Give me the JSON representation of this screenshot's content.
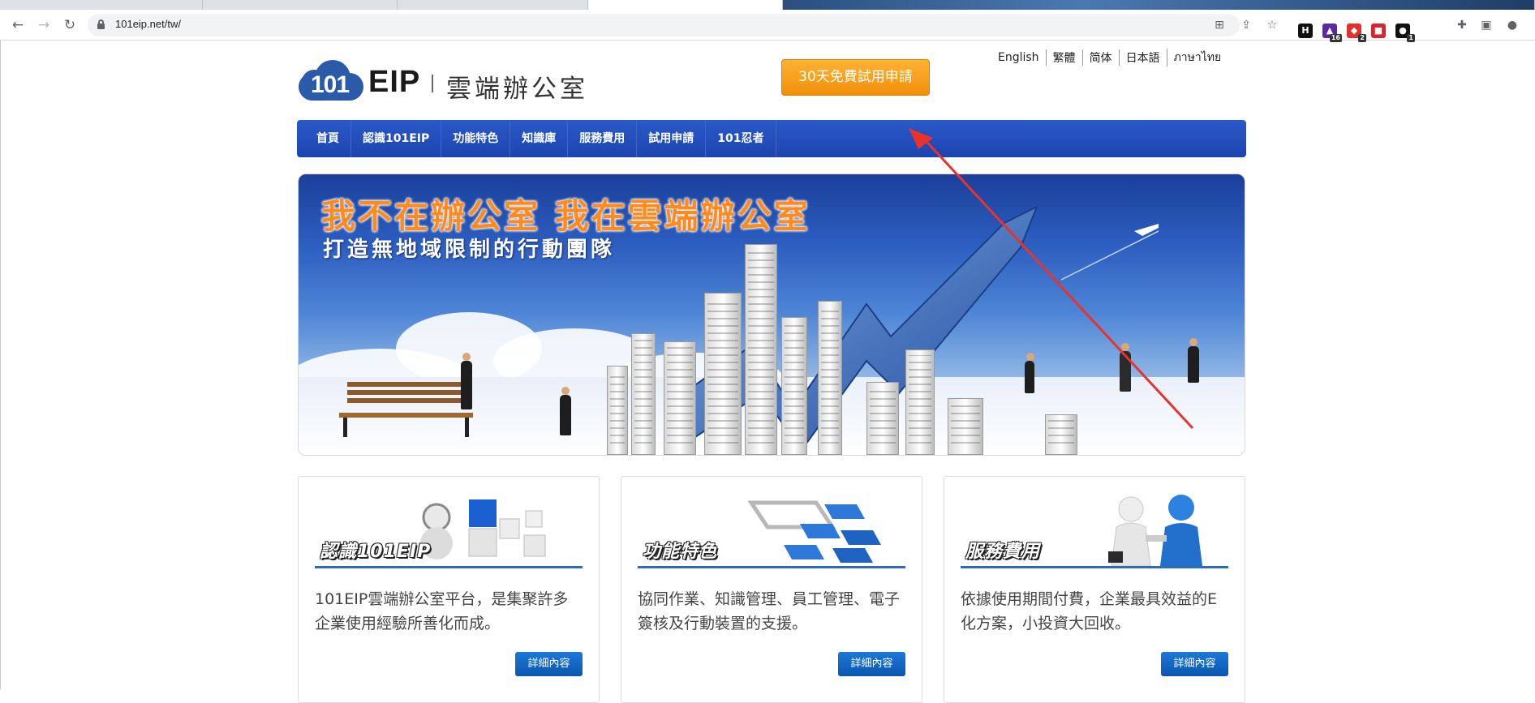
{
  "browser": {
    "url": "101eip.net/tw/",
    "extensions": [
      {
        "name": "honey-extension-icon",
        "glyph": "H",
        "color": "#111111",
        "badge": ""
      },
      {
        "name": "graduation-extension-icon",
        "glyph": "▲",
        "color": "#5b2aa0",
        "badge": "16"
      },
      {
        "name": "red-extension-icon",
        "glyph": "◆",
        "color": "#e0312c",
        "badge": "2"
      },
      {
        "name": "shield-extension-icon",
        "glyph": "■",
        "color": "#d9232f",
        "badge": ""
      },
      {
        "name": "dark-extension-icon",
        "glyph": "●",
        "color": "#111111",
        "badge": "1"
      }
    ]
  },
  "header": {
    "logo_number": "101",
    "logo_brand": "EIP",
    "logo_tagline": "雲端辦公室",
    "trial_button": "30天免費試用申請",
    "languages": [
      "English",
      "繁體",
      "简体",
      "日本語",
      "ภาษาไทย"
    ]
  },
  "nav": {
    "items": [
      "首頁",
      "認識101EIP",
      "功能特色",
      "知識庫",
      "服務費用",
      "試用申請",
      "101忍者"
    ]
  },
  "hero": {
    "headline": "我不在辦公室  我在雲端辦公室",
    "subheadline": "打造無地域限制的行動團隊"
  },
  "cards": [
    {
      "title": "認識101EIP",
      "description": "101EIP雲端辦公室平台，是集聚許多企業使用經驗所善化而成。",
      "button": "詳細內容"
    },
    {
      "title": "功能特色",
      "description": "協同作業、知識管理、員工管理、電子簽核及行動裝置的支援。",
      "button": "詳細內容"
    },
    {
      "title": "服務費用",
      "description": "依據使用期間付費，企業最具效益的E化方案，小投資大回收。",
      "button": "詳細內容"
    }
  ],
  "colors": {
    "nav_blue": "#2450c0",
    "trial_orange": "#f7a21c",
    "button_blue": "#0f62c0",
    "annotation_red": "#e8332c"
  }
}
